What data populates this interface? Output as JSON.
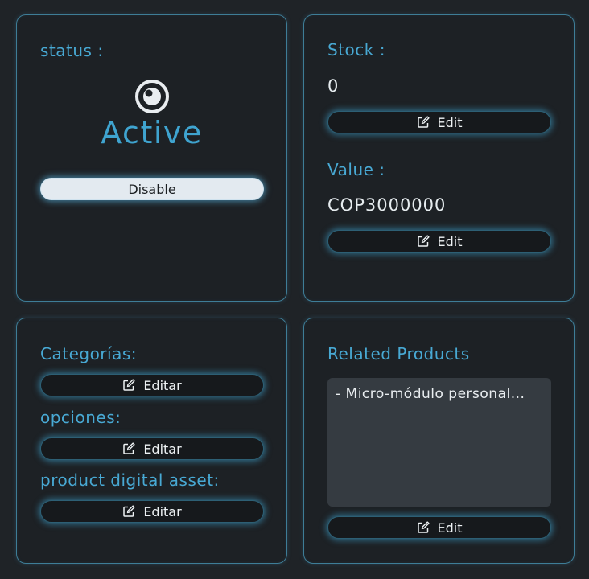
{
  "status_panel": {
    "label": "status :",
    "status_text": "Active",
    "toggle_label": "Disable"
  },
  "stock_panel": {
    "stock_label": "Stock :",
    "stock_value": "0",
    "stock_edit_label": "Edit",
    "value_label": "Value :",
    "value_amount": "COP3000000",
    "value_edit_label": "Edit"
  },
  "categories_panel": {
    "categories_label": "Categorías:",
    "categories_edit_label": "Editar",
    "options_label": "opciones:",
    "options_edit_label": "Editar",
    "asset_label": "product digital asset:",
    "asset_edit_label": "Editar"
  },
  "related_panel": {
    "title": "Related Products",
    "items": [
      "- Micro-módulo personal..."
    ],
    "edit_label": "Edit"
  },
  "colors": {
    "accent": "#48a9d4",
    "panel_border": "#3e7d97",
    "background": "#1f2327",
    "button_dark": "#16191c",
    "button_light": "#e3eaf0"
  },
  "icons": {
    "status": "eye-icon",
    "edit": "edit-icon"
  }
}
